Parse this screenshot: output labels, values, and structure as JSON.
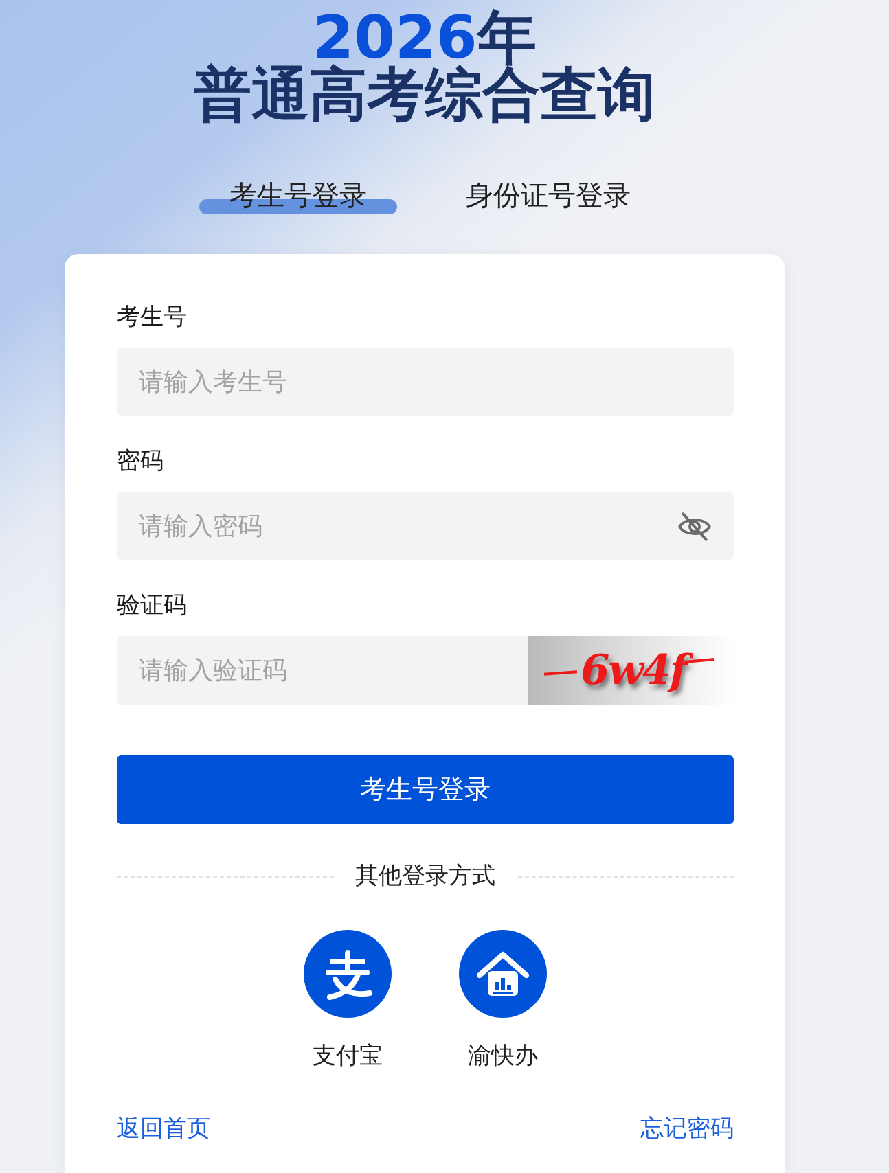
{
  "header": {
    "year": "2026",
    "year_suffix": "年",
    "title": "普通高考综合查询"
  },
  "tabs": [
    {
      "label": "考生号登录",
      "selected": true
    },
    {
      "label": "身份证号登录",
      "selected": false
    }
  ],
  "form": {
    "fields": [
      {
        "kind": "text",
        "label": "考生号",
        "placeholder": "请输入考生号"
      },
      {
        "kind": "password",
        "label": "密码",
        "placeholder": "请输入密码",
        "password_visible": false
      },
      {
        "kind": "captcha",
        "label": "验证码",
        "placeholder": "请输入验证码",
        "captcha": "6w4f"
      }
    ],
    "submit": "考生号登录"
  },
  "other_login": {
    "title": "其他登录方式",
    "methods": [
      {
        "kind": "pay",
        "label": "支付宝"
      },
      {
        "kind": "house",
        "label": "渝快办"
      }
    ]
  },
  "footer": {
    "links": [
      "返回首页",
      "忘记密码"
    ]
  }
}
